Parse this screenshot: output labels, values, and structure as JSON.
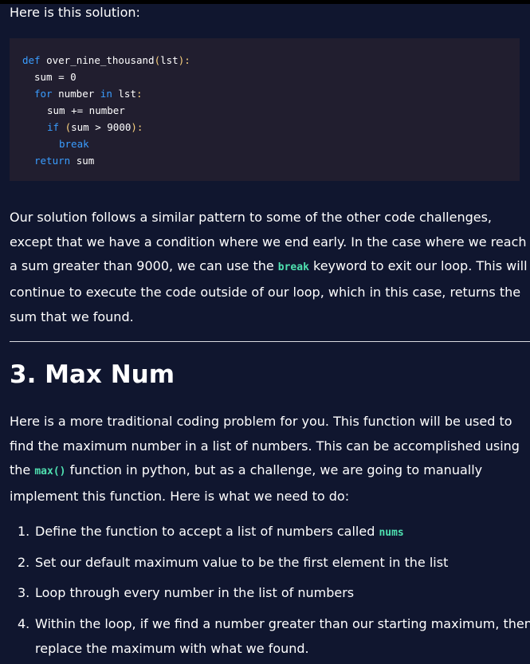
{
  "intro": "Here is this solution:",
  "code": {
    "line1_kw": "def",
    "line1_name": "over_nine_thousand",
    "line1_open": "(",
    "line1_param": "lst",
    "line1_close": "):",
    "line2": "sum = 0",
    "line3_kw1": "for",
    "line3_var": "number",
    "line3_kw2": "in",
    "line3_iter": "lst",
    "line3_colon": ":",
    "line4": "sum += number",
    "line5_kw": "if",
    "line5_open": "(",
    "line5_cond": "sum > 9000",
    "line5_close": "):",
    "line6_kw": "break",
    "line7_kw": "return",
    "line7_val": "sum"
  },
  "paragraph1": {
    "l1": "Our solution follows a similar pattern to some of the other code challenges,",
    "l2": "except that we have a condition where we end early. In the case where we reach",
    "l3_a": "a sum greater than 9000, we can use the ",
    "l3_code": "break",
    "l3_b": " keyword to exit our loop. This will",
    "l4": "continue to execute the code outside of our loop, which in this case, returns the",
    "l5": "sum that we found."
  },
  "heading": "3. Max Num",
  "paragraph2": {
    "l1": "Here is a more traditional coding problem for you. This function will be used to",
    "l2": "find the maximum number in a list of numbers. This can be accomplished using",
    "l3_a": "the ",
    "l3_code": "max()",
    "l3_b": " function in python, but as a challenge, we are going to manually",
    "l4": "implement this function. Here is what we need to do:"
  },
  "steps": [
    {
      "num": "1.",
      "l1_a": "Define the function to accept a list of numbers called ",
      "l1_code": "nums"
    },
    {
      "num": "2.",
      "l1": "Set our default maximum value to be the first element in the list"
    },
    {
      "num": "3.",
      "l1": "Loop through every number in the list of numbers"
    },
    {
      "num": "4.",
      "l1": "Within the loop, if we find a number greater than our starting maximum, then",
      "l2": "replace the maximum with what we found."
    }
  ]
}
